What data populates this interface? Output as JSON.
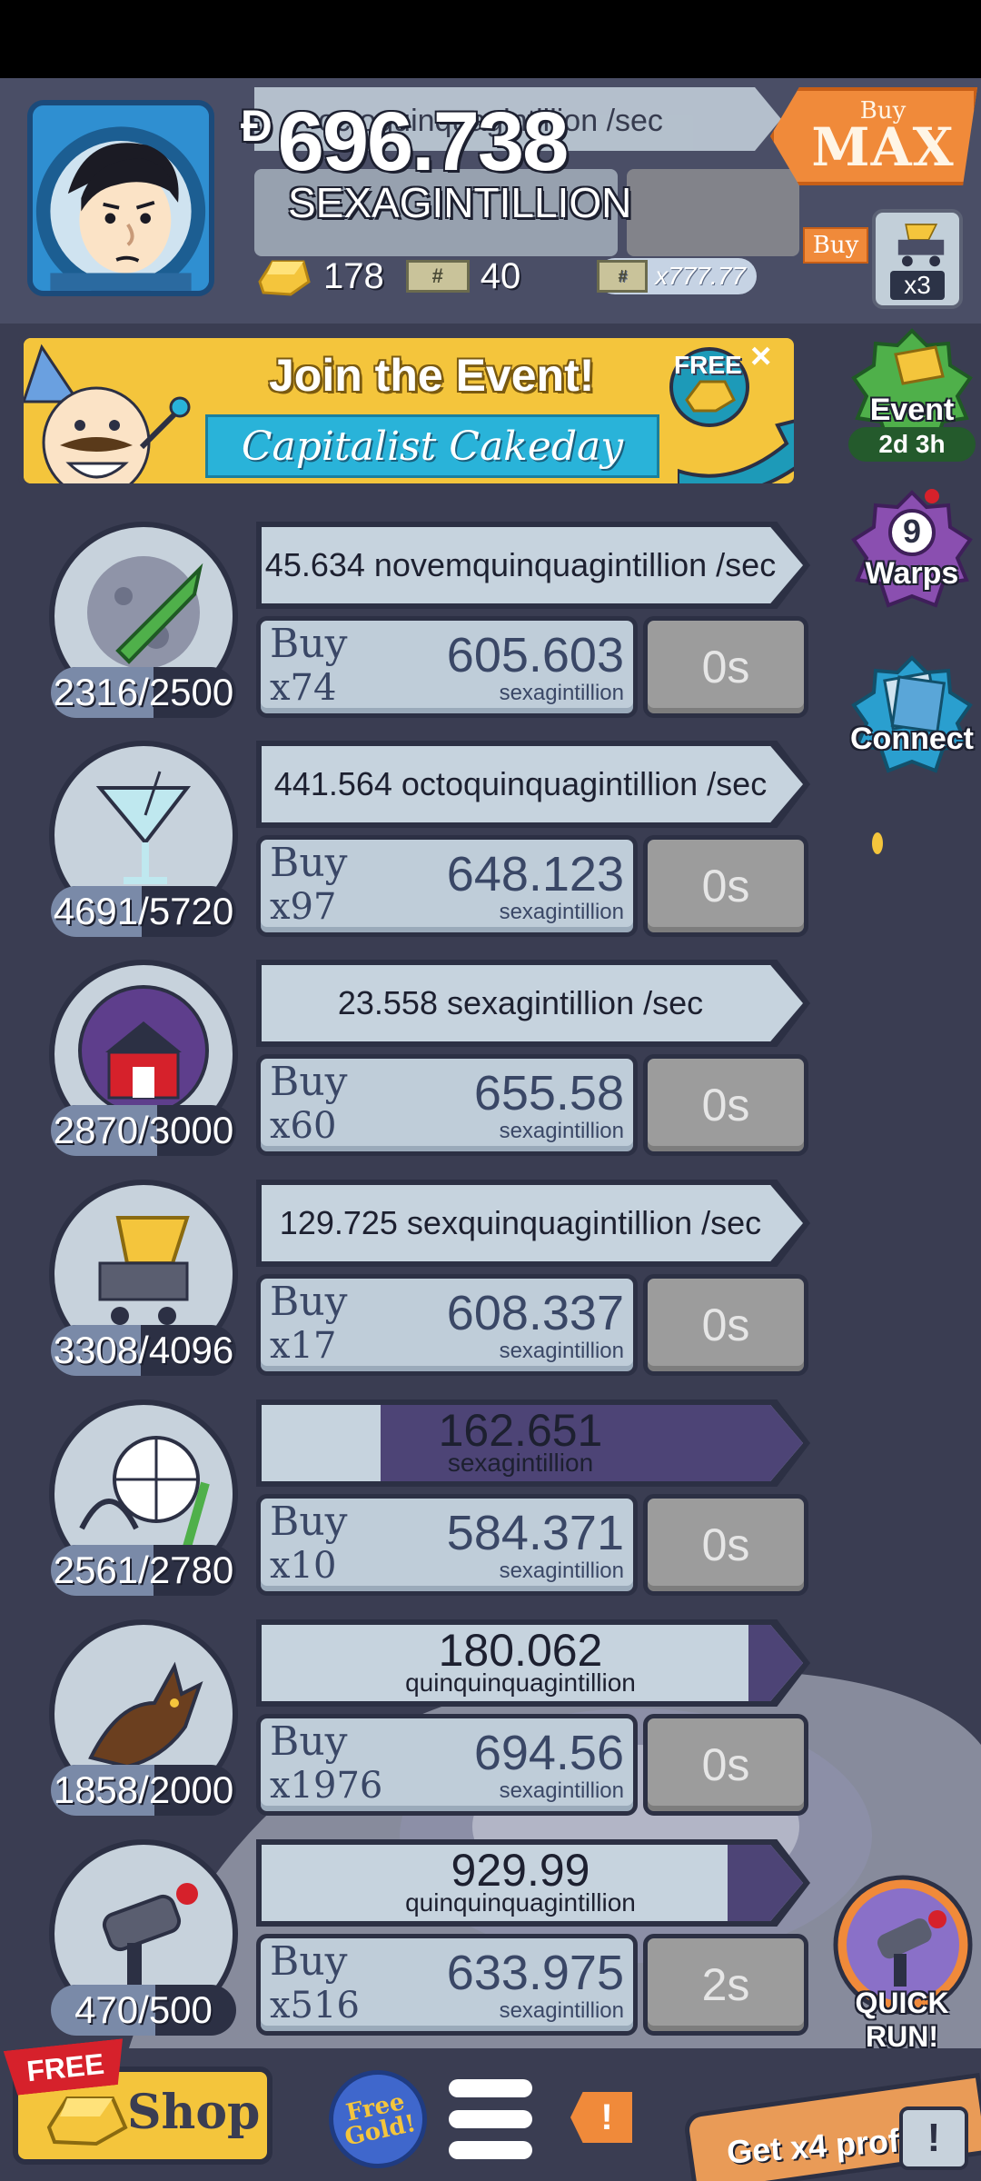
{
  "header": {
    "money_value": "696.738",
    "money_unit": "SEXAGINTILLION",
    "money_symbol": "Ð",
    "background_income": "octoquinquagintillion /sec",
    "gold_count": "178",
    "megabucks_count": "40",
    "bill_symbol": "#",
    "multiplier": "x777.77",
    "buymax_small": "Buy",
    "buymax_big": "MAX",
    "buy_tag": "Buy",
    "cart_multiplier": "x3"
  },
  "event_banner": {
    "title": "Join the Event!",
    "subtitle": "Capitalist Cakeday",
    "free_label": "FREE",
    "close": "×"
  },
  "side_buttons": {
    "event_label": "Event",
    "event_timer": "2d 3h",
    "warps_count": "9",
    "warps_label": "Warps",
    "connect_label": "Connect"
  },
  "businesses": [
    {
      "icon": "moon-rocket-icon",
      "count": "2316/2500",
      "count_fraction": 0.926,
      "income": "45.634 novemquinquagintillion /sec",
      "income_progress": 0,
      "buy_label": "Buy",
      "buy_mult": "x74",
      "cost": "605.603",
      "cost_unit": "sexagintillion",
      "timer": "0s"
    },
    {
      "icon": "cocktail-icon",
      "count": "4691/5720",
      "count_fraction": 0.82,
      "income": "441.564 octoquinquagintillion /sec",
      "income_progress": 0,
      "buy_label": "Buy",
      "buy_mult": "x97",
      "cost": "648.123",
      "cost_unit": "sexagintillion",
      "timer": "0s"
    },
    {
      "icon": "barn-dome-icon",
      "count": "2870/3000",
      "count_fraction": 0.957,
      "income": "23.558 sexagintillion /sec",
      "income_progress": 0,
      "buy_label": "Buy",
      "buy_mult": "x60",
      "cost": "655.58",
      "cost_unit": "sexagintillion",
      "timer": "0s"
    },
    {
      "icon": "cheese-cart-icon",
      "count": "3308/4096",
      "count_fraction": 0.808,
      "income": "129.725 sexquinquagintillion /sec",
      "income_progress": 0,
      "buy_label": "Buy",
      "buy_mult": "x17",
      "cost": "608.337",
      "cost_unit": "sexagintillion",
      "timer": "0s"
    },
    {
      "icon": "amusement-park-icon",
      "count": "2561/2780",
      "count_fraction": 0.921,
      "income_big": "162.651",
      "income_unit": "sexagintillion",
      "income_progress": 0.78,
      "buy_label": "Buy",
      "buy_mult": "x10",
      "cost": "584.371",
      "cost_unit": "sexagintillion",
      "timer": "0s"
    },
    {
      "icon": "werewolf-icon",
      "count": "1858/2000",
      "count_fraction": 0.929,
      "income_big": "180.062",
      "income_unit": "quinquinquagintillion",
      "income_progress": 0.1,
      "buy_label": "Buy",
      "buy_mult": "x1976",
      "cost": "694.56",
      "cost_unit": "sexagintillion",
      "timer": "0s"
    },
    {
      "icon": "ray-gun-icon",
      "count": "470/500",
      "count_fraction": 0.94,
      "income_big": "929.99",
      "income_unit": "quinquinquagintillion",
      "income_progress": 0.14,
      "buy_label": "Buy",
      "buy_mult": "x516",
      "cost": "633.975",
      "cost_unit": "sexagintillion",
      "timer": "2s"
    }
  ],
  "quick_run": {
    "label": "QUICK RUN!"
  },
  "bottom_bar": {
    "free_ribbon": "FREE",
    "shop_label": "Shop",
    "free_gold_line1": "Free",
    "free_gold_line2": "Gold!",
    "alert": "!",
    "tv_text": "Get x4 profit!",
    "tv_icon": "!"
  },
  "colors": {
    "background": "#3a3d52",
    "panel": "#c6d3de",
    "progress": "#4d4476",
    "accent_orange": "#f08a3a",
    "gold": "#f4c53c"
  }
}
